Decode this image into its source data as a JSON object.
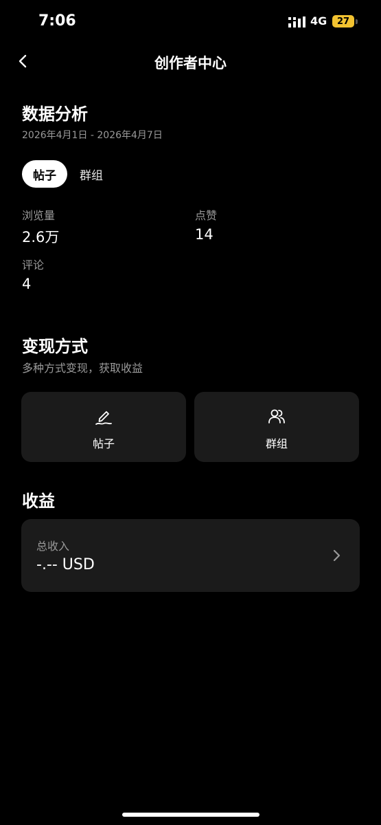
{
  "status_bar": {
    "time": "7:06",
    "network": "4G",
    "battery": "27"
  },
  "nav": {
    "title": "创作者中心"
  },
  "analytics": {
    "title": "数据分析",
    "date_range": "2026年4月1日 - 2026年4月7日",
    "tabs": [
      {
        "label": "帖子",
        "active": true
      },
      {
        "label": "群组",
        "active": false
      }
    ],
    "metrics": {
      "views": {
        "label": "浏览量",
        "value": "2.6万"
      },
      "likes": {
        "label": "点赞",
        "value": "14"
      },
      "comments": {
        "label": "评论",
        "value": "4"
      }
    }
  },
  "monetization": {
    "title": "变现方式",
    "subtitle": "多种方式变现，获取收益",
    "cards": [
      {
        "label": "帖子",
        "icon": "edit-pen-icon"
      },
      {
        "label": "群组",
        "icon": "group-users-icon"
      }
    ]
  },
  "earnings": {
    "title": "收益",
    "total_label": "总收入",
    "total_value": "-.-- USD"
  },
  "colors": {
    "background": "#000000",
    "card": "#1b1b1b",
    "muted": "#9a9a9a",
    "battery": "#f2c230"
  }
}
